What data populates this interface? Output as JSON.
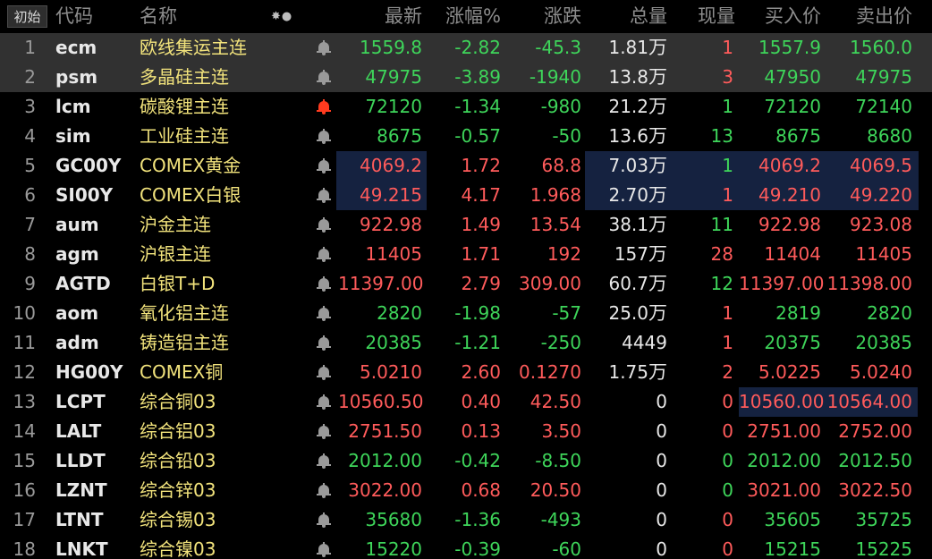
{
  "header": {
    "init_button": "初始",
    "icons_text": "✸●",
    "columns": {
      "code": "代码",
      "name": "名称",
      "last": "最新",
      "pct": "涨幅%",
      "chg": "涨跌",
      "vol": "总量",
      "cur": "现量",
      "bid": "买入价",
      "ask": "卖出价"
    }
  },
  "colors": {
    "up": "#ff5b5b",
    "down": "#3ed55a",
    "name": "#f2e37c",
    "alert_bell": "#ff3b1f",
    "bell": "#9a9a9a",
    "row_highlight": "#313131",
    "box_highlight": "#152240"
  },
  "rows": [
    {
      "idx": "1",
      "code": "ecm",
      "name": "欧线集运主连",
      "last": "1559.8",
      "pct": "-2.82",
      "chg": "-45.3",
      "vol_num": "1.81",
      "vol_unit": "万",
      "cur": "1",
      "bid": "1557.9",
      "ask": "1560.0",
      "dir": "down",
      "cur_dir": "up",
      "hl": true,
      "alert": false
    },
    {
      "idx": "2",
      "code": "psm",
      "name": "多晶硅主连",
      "last": "47975",
      "pct": "-3.89",
      "chg": "-1940",
      "vol_num": "13.8",
      "vol_unit": "万",
      "cur": "3",
      "bid": "47950",
      "ask": "47975",
      "dir": "down",
      "cur_dir": "up",
      "hl": true,
      "alert": false
    },
    {
      "idx": "3",
      "code": "lcm",
      "name": "碳酸锂主连",
      "last": "72120",
      "pct": "-1.34",
      "chg": "-980",
      "vol_num": "21.2",
      "vol_unit": "万",
      "cur": "1",
      "bid": "72120",
      "ask": "72140",
      "dir": "down",
      "cur_dir": "down",
      "hl": false,
      "alert": true
    },
    {
      "idx": "4",
      "code": "sim",
      "name": "工业硅主连",
      "last": "8675",
      "pct": "-0.57",
      "chg": "-50",
      "vol_num": "13.6",
      "vol_unit": "万",
      "cur": "13",
      "bid": "8675",
      "ask": "8680",
      "dir": "down",
      "cur_dir": "down",
      "hl": false,
      "alert": false
    },
    {
      "idx": "5",
      "code": "GC00Y",
      "name": "COMEX黄金",
      "last": "4069.2",
      "pct": "1.72",
      "chg": "68.8",
      "vol_num": "7.03",
      "vol_unit": "万",
      "cur": "1",
      "bid": "4069.2",
      "ask": "4069.5",
      "dir": "up",
      "cur_dir": "down",
      "hl": false,
      "alert": false,
      "box": true
    },
    {
      "idx": "6",
      "code": "SI00Y",
      "name": "COMEX白银",
      "last": "49.215",
      "pct": "4.17",
      "chg": "1.968",
      "vol_num": "2.70",
      "vol_unit": "万",
      "cur": "1",
      "bid": "49.210",
      "ask": "49.220",
      "dir": "up",
      "cur_dir": "up",
      "hl": false,
      "alert": false,
      "box": true
    },
    {
      "idx": "7",
      "code": "aum",
      "name": "沪金主连",
      "last": "922.98",
      "pct": "1.49",
      "chg": "13.54",
      "vol_num": "38.1",
      "vol_unit": "万",
      "cur": "11",
      "bid": "922.98",
      "ask": "923.08",
      "dir": "up",
      "cur_dir": "down",
      "hl": false,
      "alert": false
    },
    {
      "idx": "8",
      "code": "agm",
      "name": "沪银主连",
      "last": "11405",
      "pct": "1.71",
      "chg": "192",
      "vol_num": "157",
      "vol_unit": "万",
      "cur": "28",
      "bid": "11404",
      "ask": "11405",
      "dir": "up",
      "cur_dir": "up",
      "hl": false,
      "alert": false
    },
    {
      "idx": "9",
      "code": "AGTD",
      "name": "白银T+D",
      "last": "11397.00",
      "pct": "2.79",
      "chg": "309.00",
      "vol_num": "60.7",
      "vol_unit": "万",
      "cur": "12",
      "bid": "11397.00",
      "ask": "11398.00",
      "dir": "up",
      "cur_dir": "down",
      "hl": false,
      "alert": false
    },
    {
      "idx": "10",
      "code": "aom",
      "name": "氧化铝主连",
      "last": "2820",
      "pct": "-1.98",
      "chg": "-57",
      "vol_num": "25.0",
      "vol_unit": "万",
      "cur": "1",
      "bid": "2819",
      "ask": "2820",
      "dir": "down",
      "cur_dir": "up",
      "hl": false,
      "alert": false
    },
    {
      "idx": "11",
      "code": "adm",
      "name": "铸造铝主连",
      "last": "20385",
      "pct": "-1.21",
      "chg": "-250",
      "vol_num": "4449",
      "vol_unit": "",
      "cur": "1",
      "bid": "20375",
      "ask": "20385",
      "dir": "down",
      "cur_dir": "up",
      "hl": false,
      "alert": false
    },
    {
      "idx": "12",
      "code": "HG00Y",
      "name": "COMEX铜",
      "last": "5.0210",
      "pct": "2.60",
      "chg": "0.1270",
      "vol_num": "1.75",
      "vol_unit": "万",
      "cur": "2",
      "bid": "5.0225",
      "ask": "5.0240",
      "dir": "up",
      "cur_dir": "up",
      "hl": false,
      "alert": false
    },
    {
      "idx": "13",
      "code": "LCPT",
      "name": "综合铜03",
      "last": "10560.50",
      "pct": "0.40",
      "chg": "42.50",
      "vol_num": "0",
      "vol_unit": "",
      "cur": "0",
      "bid": "10560.00",
      "ask": "10564.00",
      "dir": "up",
      "cur_dir": "up",
      "hl": false,
      "alert": false,
      "box_bid": true
    },
    {
      "idx": "14",
      "code": "LALT",
      "name": "综合铝03",
      "last": "2751.50",
      "pct": "0.13",
      "chg": "3.50",
      "vol_num": "0",
      "vol_unit": "",
      "cur": "0",
      "bid": "2751.00",
      "ask": "2752.00",
      "dir": "up",
      "cur_dir": "up",
      "hl": false,
      "alert": false
    },
    {
      "idx": "15",
      "code": "LLDT",
      "name": "综合铅03",
      "last": "2012.00",
      "pct": "-0.42",
      "chg": "-8.50",
      "vol_num": "0",
      "vol_unit": "",
      "cur": "0",
      "bid": "2012.00",
      "ask": "2012.50",
      "dir": "down",
      "cur_dir": "down",
      "hl": false,
      "alert": false
    },
    {
      "idx": "16",
      "code": "LZNT",
      "name": "综合锌03",
      "last": "3022.00",
      "pct": "0.68",
      "chg": "20.50",
      "vol_num": "0",
      "vol_unit": "",
      "cur": "0",
      "bid": "3021.00",
      "ask": "3022.50",
      "dir": "up",
      "cur_dir": "down",
      "hl": false,
      "alert": false
    },
    {
      "idx": "17",
      "code": "LTNT",
      "name": "综合锡03",
      "last": "35680",
      "pct": "-1.36",
      "chg": "-493",
      "vol_num": "0",
      "vol_unit": "",
      "cur": "0",
      "bid": "35605",
      "ask": "35725",
      "dir": "down",
      "cur_dir": "up",
      "hl": false,
      "alert": false
    },
    {
      "idx": "18",
      "code": "LNKT",
      "name": "综合镍03",
      "last": "15220",
      "pct": "-0.39",
      "chg": "-60",
      "vol_num": "0",
      "vol_unit": "",
      "cur": "0",
      "bid": "15215",
      "ask": "15225",
      "dir": "down",
      "cur_dir": "up",
      "hl": false,
      "alert": false
    }
  ]
}
